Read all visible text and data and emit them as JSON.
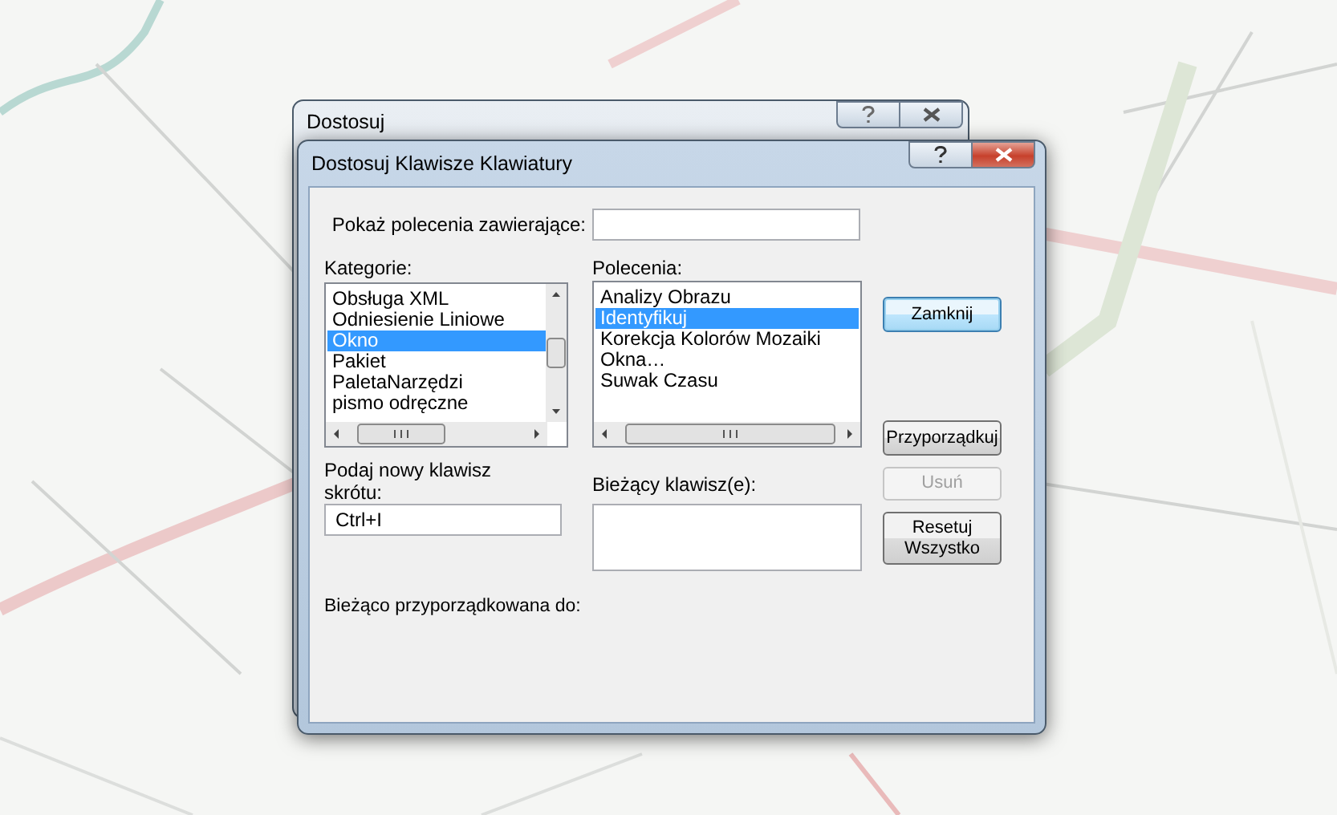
{
  "background_window": {
    "title": "Dostosuj"
  },
  "window": {
    "title": "Dostosuj Klawisze Klawiatury"
  },
  "search": {
    "label": "Pokaż polecenia zawierające:"
  },
  "categories": {
    "label": "Kategorie:",
    "items": [
      {
        "label": "Obsługa XML",
        "selected": false
      },
      {
        "label": "Odniesienie Liniowe",
        "selected": false
      },
      {
        "label": "Okno",
        "selected": true
      },
      {
        "label": "Pakiet",
        "selected": false
      },
      {
        "label": "PaletaNarzędzi",
        "selected": false
      },
      {
        "label": "pismo odręczne",
        "selected": false
      }
    ]
  },
  "commands": {
    "label": "Polecenia:",
    "items": [
      {
        "label": "Analizy Obrazu",
        "selected": false
      },
      {
        "label": "Identyfikuj",
        "selected": true
      },
      {
        "label": "Korekcja Kolorów Mozaiki",
        "selected": false
      },
      {
        "label": "Okna…",
        "selected": false
      },
      {
        "label": "Suwak Czasu",
        "selected": false
      }
    ]
  },
  "shortcut": {
    "label": "Podaj nowy klawisz skrótu:",
    "value": "Ctrl+I"
  },
  "current_keys": {
    "label": "Bieżący klawisz(e):"
  },
  "assigned_to": {
    "label": "Bieżąco przyporządkowana do:"
  },
  "buttons": [
    {
      "label": "Zamknij",
      "default": true,
      "disabled": false
    },
    {
      "label": "Przyporządkuj",
      "default": false,
      "disabled": false
    },
    {
      "label": "Usuń",
      "default": false,
      "disabled": true
    },
    {
      "label": "Resetuj Wszystko",
      "default": false,
      "disabled": false
    }
  ]
}
